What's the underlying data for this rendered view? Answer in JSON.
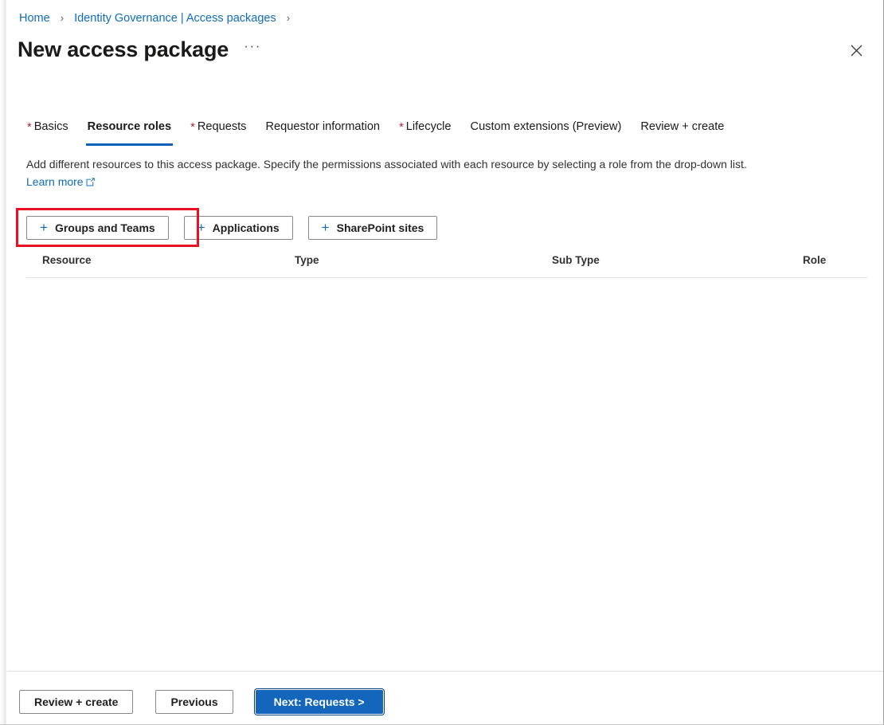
{
  "breadcrumb": {
    "items": [
      {
        "label": "Home"
      },
      {
        "label": "Identity Governance | Access packages"
      }
    ],
    "separator": "›",
    "trailing_separator": "›"
  },
  "header": {
    "title": "New access package",
    "more_menu_label": "···",
    "close_icon": "close-icon"
  },
  "tabs": [
    {
      "label": "Basics",
      "required": true,
      "active": false
    },
    {
      "label": "Resource roles",
      "required": false,
      "active": true
    },
    {
      "label": "Requests",
      "required": true,
      "active": false
    },
    {
      "label": "Requestor information",
      "required": false,
      "active": false
    },
    {
      "label": "Lifecycle",
      "required": true,
      "active": false
    },
    {
      "label": "Custom extensions (Preview)",
      "required": false,
      "active": false
    },
    {
      "label": "Review + create",
      "required": false,
      "active": false
    }
  ],
  "description": {
    "text": "Add different resources to this access package. Specify the permissions associated with each resource by selecting a role from the drop-down list.",
    "link_label": "Learn more",
    "link_icon": "external-link-icon"
  },
  "add_buttons": [
    {
      "label": "Groups and Teams",
      "icon": "plus-icon",
      "highlighted": true
    },
    {
      "label": "Applications",
      "icon": "plus-icon",
      "highlighted": false
    },
    {
      "label": "SharePoint sites",
      "icon": "plus-icon",
      "highlighted": false
    }
  ],
  "table": {
    "columns": [
      "Resource",
      "Type",
      "Sub Type",
      "Role"
    ],
    "rows": []
  },
  "footer": {
    "review_create_label": "Review + create",
    "previous_label": "Previous",
    "next_label": "Next: Requests >"
  },
  "colors": {
    "link_blue": "#0f6cbd",
    "accent_blue": "#1160b8",
    "primary_button": "#1466bc",
    "required_asterisk": "#a4262c",
    "highlight_red": "#e81123",
    "text_primary": "#201f1e",
    "border_gray": "#8a8886",
    "rule_gray": "#e1dfdd"
  }
}
